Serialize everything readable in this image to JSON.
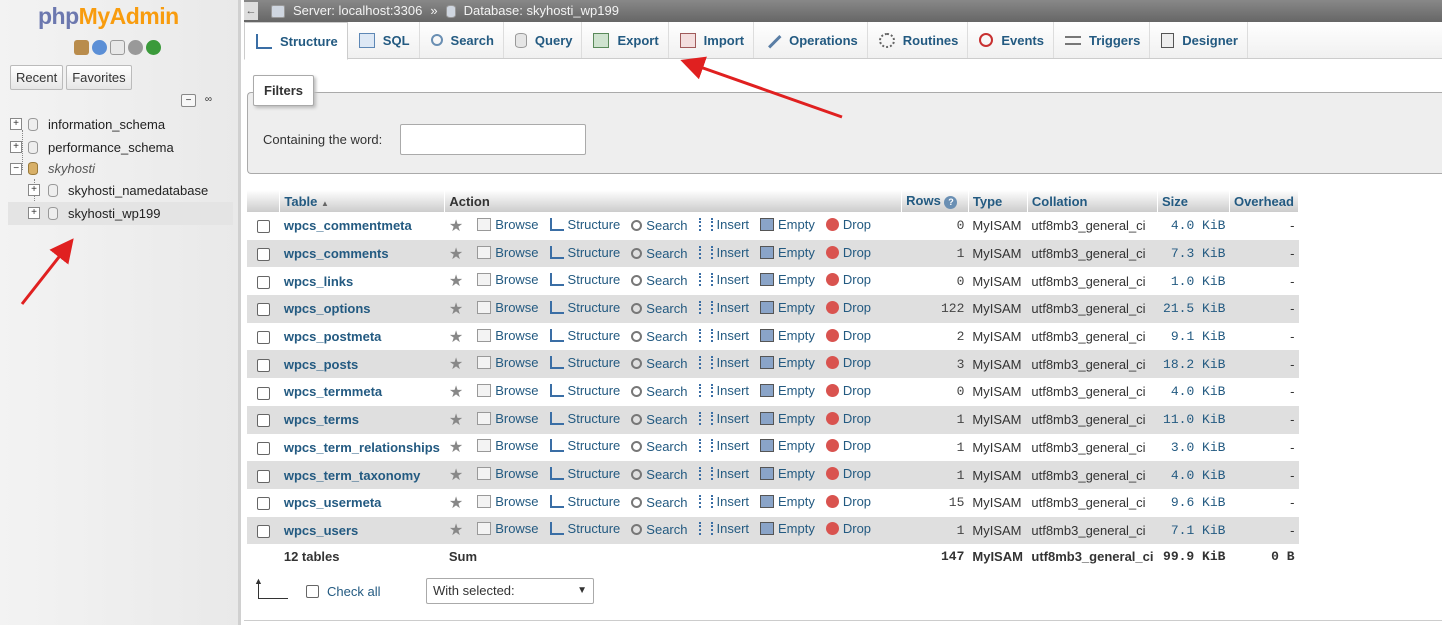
{
  "sidebar": {
    "logo": {
      "php": "php",
      "my": "My",
      "admin": "Admin"
    },
    "quick_icons": [
      "home-icon",
      "help-icon",
      "docs-icon",
      "settings-icon",
      "reload-icon"
    ],
    "tabs": [
      "Recent",
      "Favorites"
    ],
    "tree": [
      {
        "label": "information_schema",
        "expander": "+",
        "level": 0
      },
      {
        "label": "performance_schema",
        "expander": "+",
        "level": 0
      },
      {
        "label": "skyhosti",
        "expander": "−",
        "level": 0
      },
      {
        "label": "skyhosti_namedatabase",
        "expander": "+",
        "level": 1
      },
      {
        "label": "skyhosti_wp199",
        "expander": "+",
        "level": 1
      }
    ]
  },
  "breadcrumb": {
    "server": "Server: localhost:3306",
    "separator": "»",
    "database": "Database: skyhosti_wp199"
  },
  "tabs": [
    {
      "label": "Structure",
      "icon": "structure-icon",
      "active": true
    },
    {
      "label": "SQL",
      "icon": "sql-icon"
    },
    {
      "label": "Search",
      "icon": "search-icon"
    },
    {
      "label": "Query",
      "icon": "query-icon"
    },
    {
      "label": "Export",
      "icon": "export-icon"
    },
    {
      "label": "Import",
      "icon": "import-icon"
    },
    {
      "label": "Operations",
      "icon": "wrench-icon"
    },
    {
      "label": "Routines",
      "icon": "routines-icon"
    },
    {
      "label": "Events",
      "icon": "clock-icon"
    },
    {
      "label": "Triggers",
      "icon": "triggers-icon"
    },
    {
      "label": "Designer",
      "icon": "designer-icon"
    }
  ],
  "filters": {
    "legend": "Filters",
    "label": "Containing the word:",
    "value": ""
  },
  "table": {
    "headers": {
      "table": "Table",
      "action": "Action",
      "rows": "Rows",
      "type": "Type",
      "collation": "Collation",
      "size": "Size",
      "overhead": "Overhead"
    },
    "actions": [
      "Browse",
      "Structure",
      "Search",
      "Insert",
      "Empty",
      "Drop"
    ],
    "rows": [
      {
        "name": "wpcs_commentmeta",
        "rows": "0",
        "type": "MyISAM",
        "collation": "utf8mb3_general_ci",
        "size": "4.0 KiB",
        "overhead": "-"
      },
      {
        "name": "wpcs_comments",
        "rows": "1",
        "type": "MyISAM",
        "collation": "utf8mb3_general_ci",
        "size": "7.3 KiB",
        "overhead": "-"
      },
      {
        "name": "wpcs_links",
        "rows": "0",
        "type": "MyISAM",
        "collation": "utf8mb3_general_ci",
        "size": "1.0 KiB",
        "overhead": "-"
      },
      {
        "name": "wpcs_options",
        "rows": "122",
        "type": "MyISAM",
        "collation": "utf8mb3_general_ci",
        "size": "21.5 KiB",
        "overhead": "-"
      },
      {
        "name": "wpcs_postmeta",
        "rows": "2",
        "type": "MyISAM",
        "collation": "utf8mb3_general_ci",
        "size": "9.1 KiB",
        "overhead": "-"
      },
      {
        "name": "wpcs_posts",
        "rows": "3",
        "type": "MyISAM",
        "collation": "utf8mb3_general_ci",
        "size": "18.2 KiB",
        "overhead": "-"
      },
      {
        "name": "wpcs_termmeta",
        "rows": "0",
        "type": "MyISAM",
        "collation": "utf8mb3_general_ci",
        "size": "4.0 KiB",
        "overhead": "-"
      },
      {
        "name": "wpcs_terms",
        "rows": "1",
        "type": "MyISAM",
        "collation": "utf8mb3_general_ci",
        "size": "11.0 KiB",
        "overhead": "-"
      },
      {
        "name": "wpcs_term_relationships",
        "rows": "1",
        "type": "MyISAM",
        "collation": "utf8mb3_general_ci",
        "size": "3.0 KiB",
        "overhead": "-"
      },
      {
        "name": "wpcs_term_taxonomy",
        "rows": "1",
        "type": "MyISAM",
        "collation": "utf8mb3_general_ci",
        "size": "4.0 KiB",
        "overhead": "-"
      },
      {
        "name": "wpcs_usermeta",
        "rows": "15",
        "type": "MyISAM",
        "collation": "utf8mb3_general_ci",
        "size": "9.6 KiB",
        "overhead": "-"
      },
      {
        "name": "wpcs_users",
        "rows": "1",
        "type": "MyISAM",
        "collation": "utf8mb3_general_ci",
        "size": "7.1 KiB",
        "overhead": "-"
      }
    ],
    "summary": {
      "count": "12 tables",
      "action": "Sum",
      "rows": "147",
      "type": "MyISAM",
      "collation": "utf8mb3_general_ci",
      "size": "99.9 KiB",
      "overhead": "0 B"
    }
  },
  "bottom": {
    "check_all": "Check all",
    "with_selected": "With selected:"
  },
  "colors": {
    "link": "#235a81",
    "annotation_arrow": "#e02020"
  }
}
